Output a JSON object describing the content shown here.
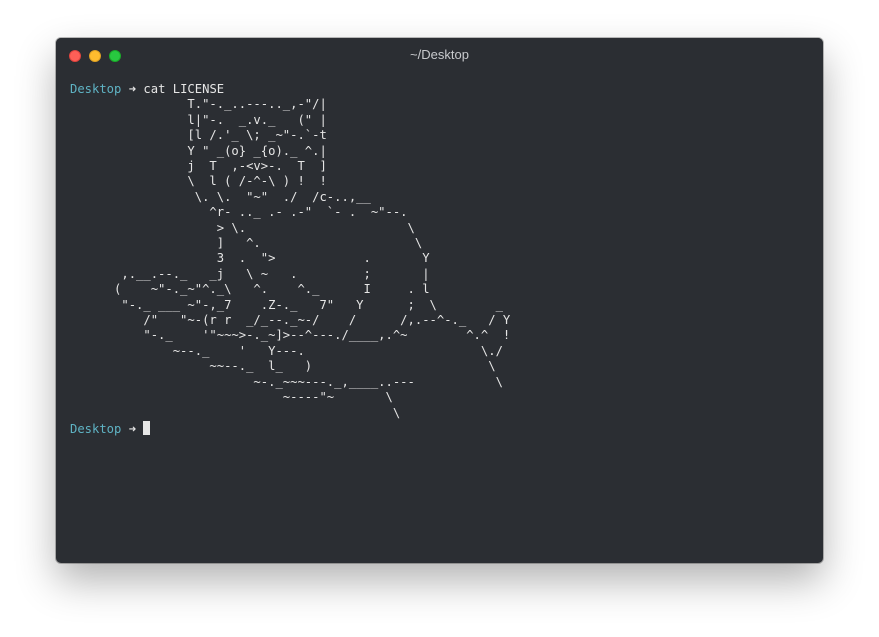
{
  "window": {
    "title": "~/Desktop",
    "traffic_lights": {
      "close_color": "#fe5f57",
      "minimize_color": "#febc2e",
      "zoom_color": "#28c840"
    }
  },
  "terminal": {
    "prompt_dir": "Desktop",
    "prompt_arrow": "➜",
    "command": "cat LICENSE",
    "output": "                T.\"-._..---.._,-\"/|\n                l|\"-.  _.v._   (\" |\n                [l /.'_ \\; _~\"-.`-t\n                Y \" _(o} _{o)._ ^.|\n                j  T  ,-<v>-.  T  ]\n                \\  l ( /-^-\\ ) !  !\n                 \\. \\.  \"~\"  ./  /c-..,__\n                   ^r- .._ .- .-\"  `- .  ~\"--.\n                    > \\.                      \\\n                    ]   ^.                     \\\n                    3  .  \">            .       Y\n       ,.__.--._   _j   \\ ~   .         ;       |\n      (    ~\"-._~\"^._\\   ^.    ^._      I     . l\n       \"-._ ___ ~\"-,_7    .Z-._   7\"   Y      ;  \\        _\n          /\"   \"~-(r r  _/_--._~-/    /      /,.--^-._   / Y\n          \"-._    '\"~~~>-._~]>--^---./____,.^~        ^.^  !\n              ~--._    '   Y---.                        \\./\n                   ~~--._  l_   )                        \\\n                         ~-._~~~---._,____..---           \\\n                             ~----\"~       \\\n                                            \\",
    "second_prompt_dir": "Desktop",
    "second_prompt_arrow": "➜",
    "fg_color": "#e6e6e6",
    "prompt_color": "#5fb3c4",
    "bg_color": "#2b2e33"
  }
}
